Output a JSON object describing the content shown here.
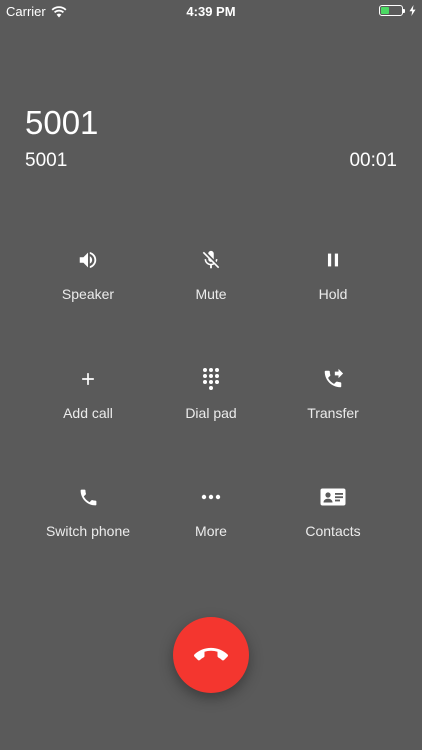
{
  "status_bar": {
    "carrier": "Carrier",
    "time": "4:39 PM",
    "battery_level": 0.35,
    "battery_color": "#4cd964"
  },
  "call": {
    "name": "5001",
    "number": "5001",
    "duration": "00:01"
  },
  "actions": [
    {
      "label": "Speaker",
      "icon": "speaker-icon"
    },
    {
      "label": "Mute",
      "icon": "mic-off-icon"
    },
    {
      "label": "Hold",
      "icon": "pause-icon"
    },
    {
      "label": "Add call",
      "icon": "plus-icon"
    },
    {
      "label": "Dial pad",
      "icon": "dialpad-icon"
    },
    {
      "label": "Transfer",
      "icon": "phone-forward-icon"
    },
    {
      "label": "Switch phone",
      "icon": "phone-icon"
    },
    {
      "label": "More",
      "icon": "more-horizontal-icon"
    },
    {
      "label": "Contacts",
      "icon": "contact-card-icon"
    }
  ],
  "end_call": {
    "icon": "call-end-icon",
    "color": "#f4362f"
  },
  "colors": {
    "background": "#5a5a5a",
    "text": "#ffffff"
  }
}
